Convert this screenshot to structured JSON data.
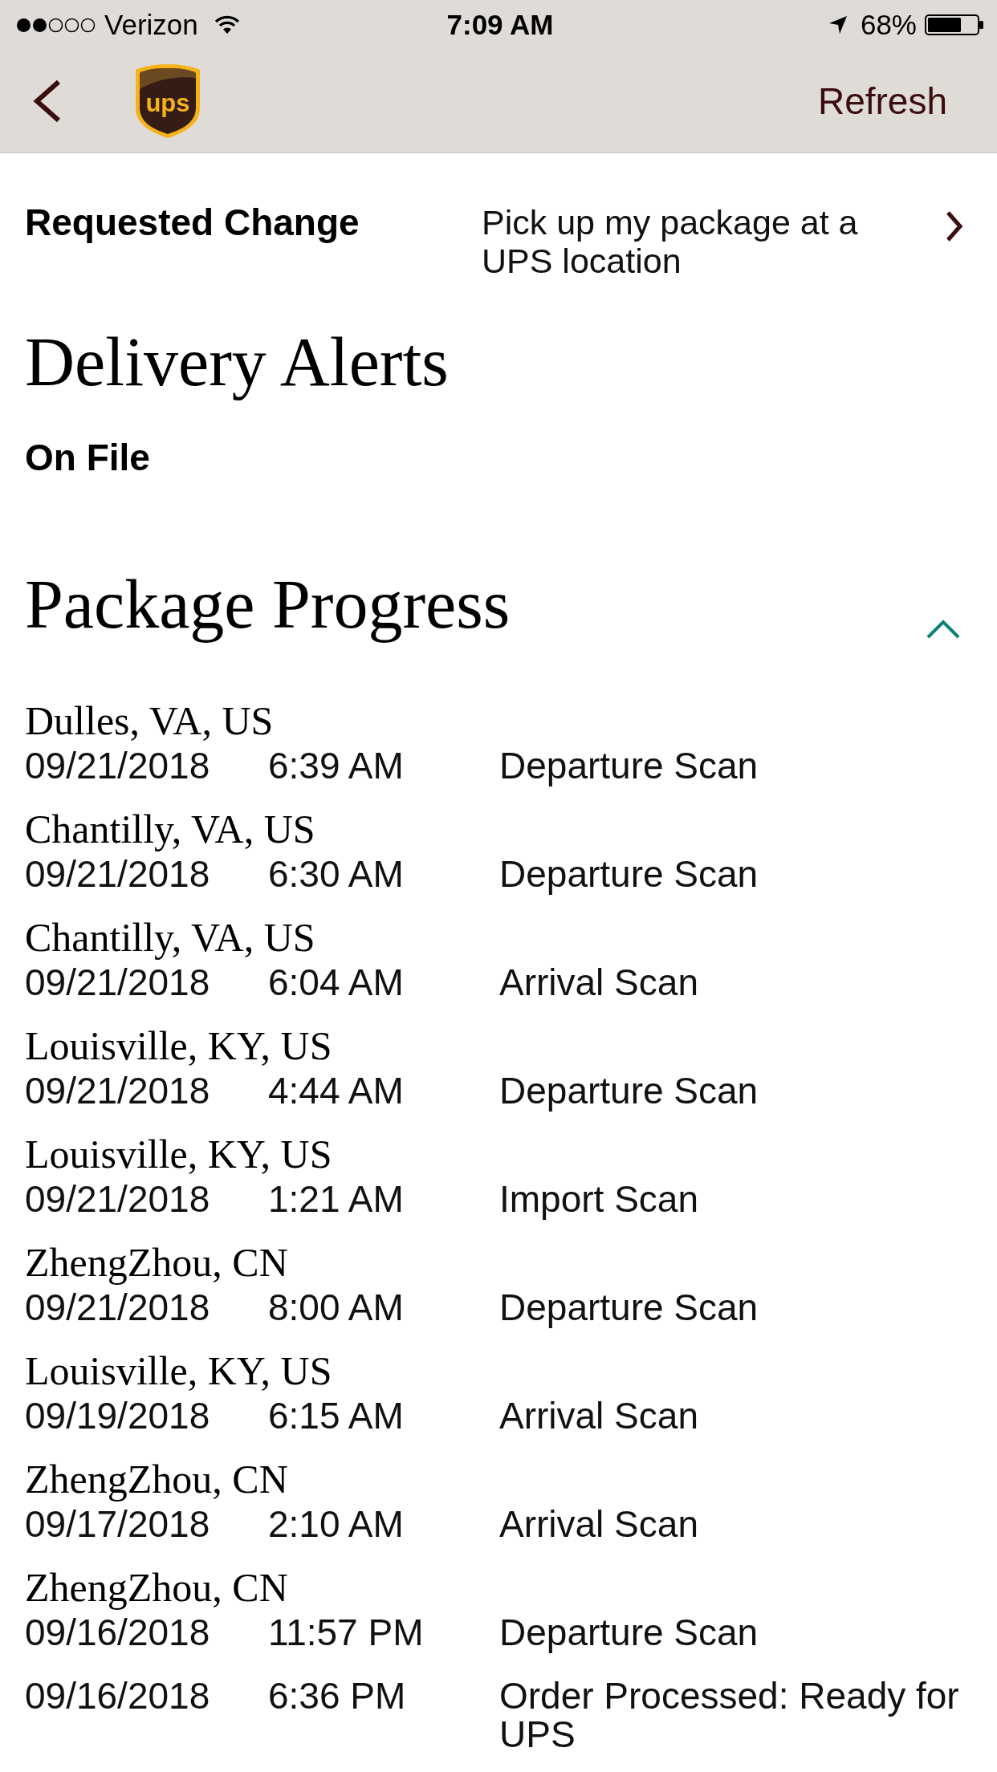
{
  "status_bar": {
    "carrier": "Verizon",
    "time": "7:09 AM",
    "battery": "68%"
  },
  "nav_bar": {
    "logo_text": "ups",
    "action": "Refresh"
  },
  "requested_change": {
    "label": "Requested Change",
    "value": "Pick up my package at a UPS location"
  },
  "delivery_alerts": {
    "title": "Delivery Alerts",
    "status": "On File"
  },
  "package_progress": {
    "title": "Package Progress",
    "expanded": true,
    "events": [
      {
        "location": "Dulles, VA, US",
        "date": "09/21/2018",
        "time": "6:39 AM",
        "activity": "Departure Scan"
      },
      {
        "location": "Chantilly, VA, US",
        "date": "09/21/2018",
        "time": "6:30 AM",
        "activity": "Departure Scan"
      },
      {
        "location": "Chantilly, VA, US",
        "date": "09/21/2018",
        "time": "6:04 AM",
        "activity": "Arrival Scan"
      },
      {
        "location": "Louisville, KY, US",
        "date": "09/21/2018",
        "time": "4:44 AM",
        "activity": "Departure Scan"
      },
      {
        "location": "Louisville, KY, US",
        "date": "09/21/2018",
        "time": "1:21 AM",
        "activity": "Import Scan"
      },
      {
        "location": "ZhengZhou, CN",
        "date": "09/21/2018",
        "time": "8:00 AM",
        "activity": "Departure Scan"
      },
      {
        "location": "Louisville, KY, US",
        "date": "09/19/2018",
        "time": "6:15 AM",
        "activity": "Arrival Scan"
      },
      {
        "location": "ZhengZhou, CN",
        "date": "09/17/2018",
        "time": "2:10 AM",
        "activity": "Arrival Scan"
      },
      {
        "location": "ZhengZhou, CN",
        "date": "09/16/2018",
        "time": "11:57 PM",
        "activity": "Departure Scan"
      },
      {
        "date": "09/16/2018",
        "time": "6:36 PM",
        "activity": "Order Processed: Ready for UPS"
      }
    ]
  }
}
